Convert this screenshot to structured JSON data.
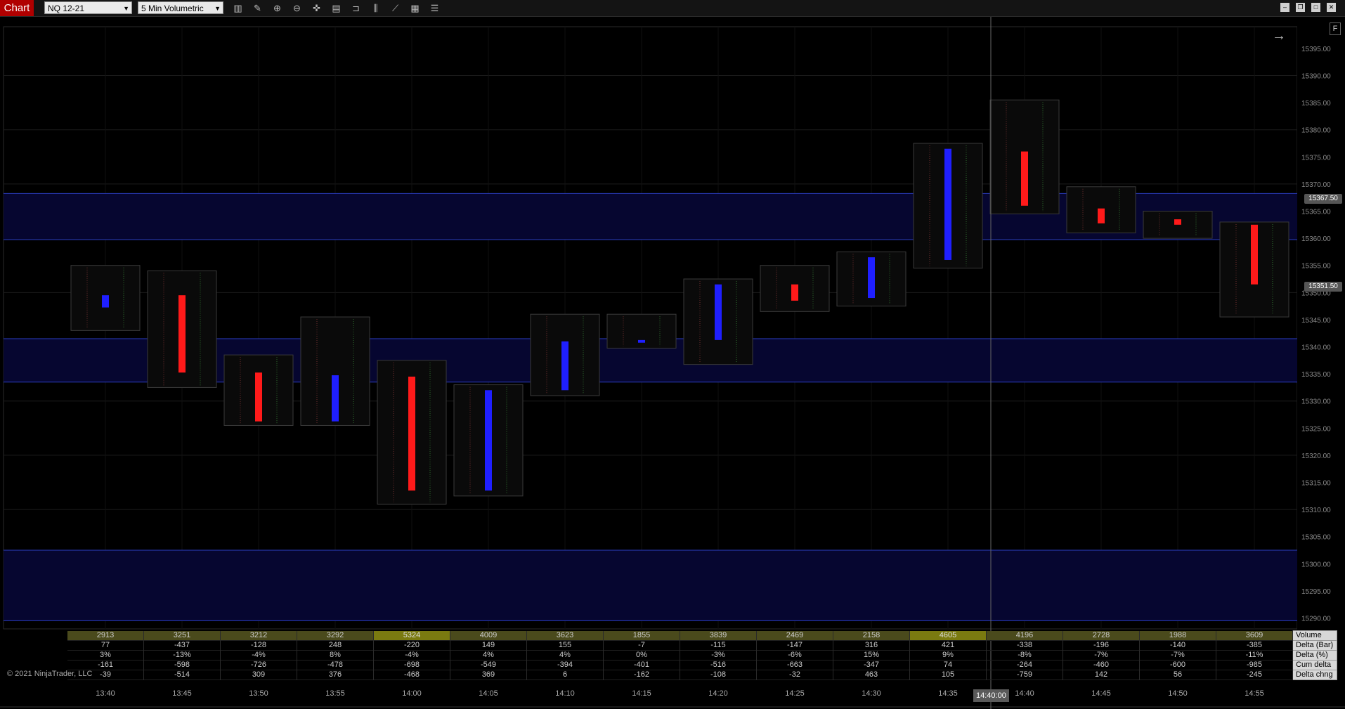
{
  "toolbar": {
    "tab_label": "Chart",
    "instrument": "NQ 12-21",
    "bar_type": "5 Min Volumetric",
    "icons": [
      "bar-type-icon",
      "draw-pencil-icon",
      "zoom-in-icon",
      "zoom-out-icon",
      "crosshair-icon",
      "data-box-icon",
      "strategy-icon",
      "indicators-icon",
      "line-chart-icon",
      "properties-icon",
      "list-icon"
    ]
  },
  "window_buttons": [
    "minimize-icon",
    "restore-icon",
    "maximize-icon",
    "close-icon"
  ],
  "colors": {
    "up": "#1f1fff",
    "down": "#ff1a1a",
    "zone": "#060630",
    "zone_line": "#2b3dbf",
    "grid": "#1c1c1c"
  },
  "f_button": "F",
  "copyright": "© 2021 NinjaTrader, LLC",
  "price_labels": {
    "current_a": "15367.50",
    "current_b": "15351.50"
  },
  "crosshair_time": "14:40:00",
  "chart_data": {
    "type": "candlestick",
    "ylim": [
      15288,
      15399
    ],
    "y_ticks": [
      15290,
      15295,
      15300,
      15305,
      15310,
      15315,
      15320,
      15325,
      15330,
      15335,
      15340,
      15345,
      15350,
      15355,
      15360,
      15365,
      15370,
      15375,
      15380,
      15385,
      15390,
      15395
    ],
    "x_ticks": [
      "13:40",
      "13:45",
      "13:50",
      "13:55",
      "14:00",
      "14:05",
      "14:10",
      "14:15",
      "14:20",
      "14:25",
      "14:30",
      "14:35",
      "14:40",
      "14:45",
      "14:50",
      "14:55"
    ],
    "zones": [
      {
        "from": 15359.75,
        "to": 15368.25
      },
      {
        "from": 15333.5,
        "to": 15341.5
      },
      {
        "from": 15289.5,
        "to": 15302.5
      }
    ],
    "bars": [
      {
        "time": "13:40",
        "open": 15347.25,
        "close": 15349.5,
        "high": 15355,
        "low": 15343
      },
      {
        "time": "13:45",
        "open": 15349.5,
        "close": 15335.25,
        "high": 15354,
        "low": 15332.5
      },
      {
        "time": "13:50",
        "open": 15335.25,
        "close": 15326.25,
        "high": 15338.5,
        "low": 15325.5
      },
      {
        "time": "13:55",
        "open": 15326.25,
        "close": 15334.75,
        "high": 15345.5,
        "low": 15325.5
      },
      {
        "time": "14:00",
        "open": 15334.5,
        "close": 15313.5,
        "high": 15337.5,
        "low": 15311
      },
      {
        "time": "14:05",
        "open": 15313.5,
        "close": 15332,
        "high": 15333,
        "low": 15312.5
      },
      {
        "time": "14:10",
        "open": 15332,
        "close": 15341,
        "high": 15346,
        "low": 15331
      },
      {
        "time": "14:15",
        "open": 15340.75,
        "close": 15341.25,
        "high": 15346,
        "low": 15339.75
      },
      {
        "time": "14:20",
        "open": 15341.25,
        "close": 15351.5,
        "high": 15352.5,
        "low": 15336.75
      },
      {
        "time": "14:25",
        "open": 15351.5,
        "close": 15348.5,
        "high": 15355,
        "low": 15346.5
      },
      {
        "time": "14:30",
        "open": 15349,
        "close": 15356.5,
        "high": 15357.5,
        "low": 15347.5
      },
      {
        "time": "14:35",
        "open": 15356,
        "close": 15376.5,
        "high": 15377.5,
        "low": 15354.5
      },
      {
        "time": "14:40",
        "open": 15376,
        "close": 15366,
        "high": 15385.5,
        "low": 15364.5
      },
      {
        "time": "14:45",
        "open": 15365.5,
        "close": 15362.75,
        "high": 15369.5,
        "low": 15361
      },
      {
        "time": "14:50",
        "open": 15363.5,
        "close": 15362.5,
        "high": 15365,
        "low": 15360
      },
      {
        "time": "14:55",
        "open": 15362.5,
        "close": 15351.5,
        "high": 15363,
        "low": 15345.5
      }
    ],
    "stats": {
      "labels": [
        "Volume",
        "Delta (Bar)",
        "Delta (%)",
        "Cum delta",
        "Delta chng"
      ],
      "rows": [
        [
          "2913",
          "3251",
          "3212",
          "3292",
          "5324",
          "4009",
          "3623",
          "1855",
          "3839",
          "2469",
          "2158",
          "4605",
          "4196",
          "2728",
          "1988",
          "3609"
        ],
        [
          "77",
          "-437",
          "-128",
          "248",
          "-220",
          "149",
          "155",
          "-7",
          "-115",
          "-147",
          "316",
          "421",
          "-338",
          "-196",
          "-140",
          "-385"
        ],
        [
          "3%",
          "-13%",
          "-4%",
          "8%",
          "-4%",
          "4%",
          "4%",
          "0%",
          "-3%",
          "-6%",
          "15%",
          "9%",
          "-8%",
          "-7%",
          "-7%",
          "-11%"
        ],
        [
          "-161",
          "-598",
          "-726",
          "-478",
          "-698",
          "-549",
          "-394",
          "-401",
          "-516",
          "-663",
          "-347",
          "74",
          "-264",
          "-460",
          "-600",
          "-985"
        ],
        [
          "-39",
          "-514",
          "309",
          "376",
          "-468",
          "369",
          "6",
          "-162",
          "-108",
          "-32",
          "463",
          "105",
          "-759",
          "142",
          "56",
          "-245"
        ]
      ],
      "volume_highlight": [
        4,
        11
      ]
    }
  }
}
